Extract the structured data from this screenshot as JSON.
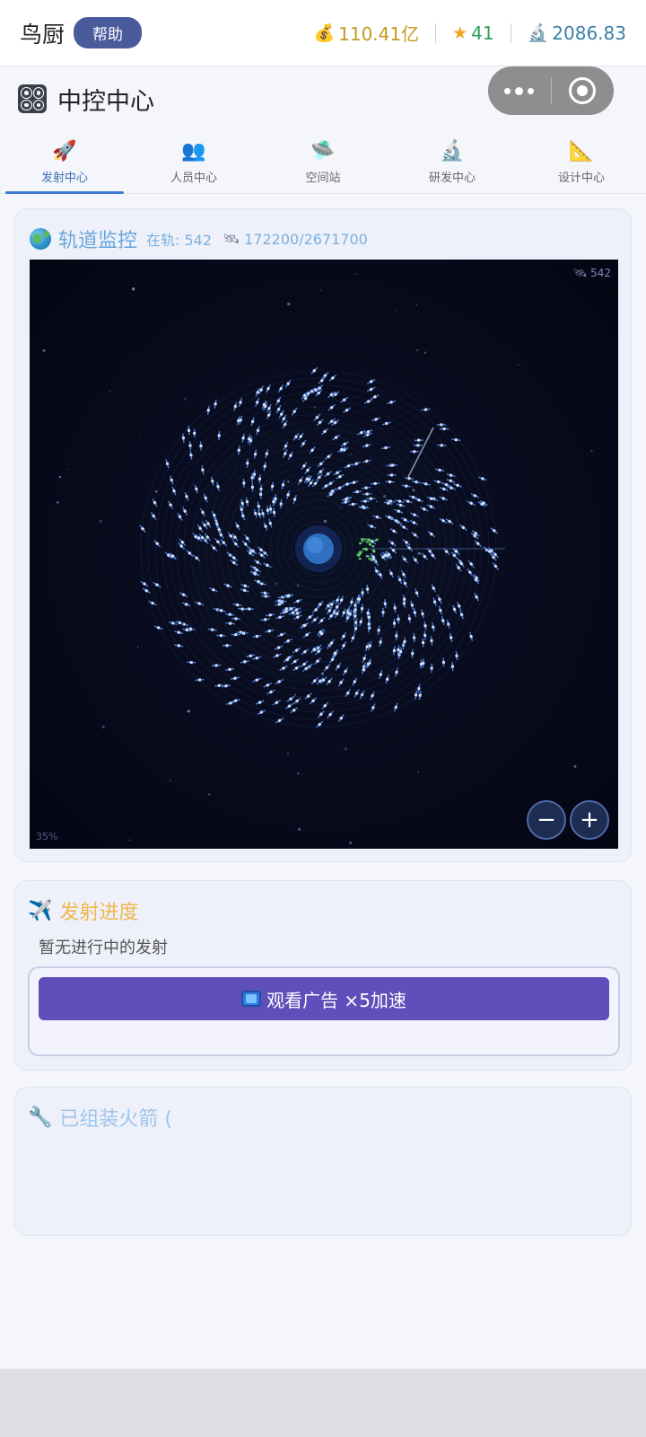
{
  "header": {
    "app_name": "鸟厨",
    "help_label": "帮助",
    "stats": {
      "money_icon": "money-bag-icon",
      "money": "110.41亿",
      "star_icon": "star-icon",
      "stars": "41",
      "science_icon": "microscope-icon",
      "science": "2086.83"
    }
  },
  "titlebar": {
    "icon": "control-panel-icon",
    "title": "中控中心"
  },
  "tabs": [
    {
      "icon": "rocket-icon",
      "glyph": "🚀",
      "label": "发射中心",
      "active": true
    },
    {
      "icon": "people-icon",
      "glyph": "👥",
      "label": "人员中心",
      "active": false
    },
    {
      "icon": "ufo-icon",
      "glyph": "🛸",
      "label": "空间站",
      "active": false
    },
    {
      "icon": "microscope-icon",
      "glyph": "🔬",
      "label": "研发中心",
      "active": false
    },
    {
      "icon": "triangle-ruler-icon",
      "glyph": "📐",
      "label": "设计中心",
      "active": false
    }
  ],
  "orbit": {
    "title": "轨道监控",
    "in_orbit": "在轨: 542",
    "progress": "172200/2671700",
    "corner_count": "542",
    "zoom": "35%",
    "zoom_out": "−",
    "zoom_in": "+"
  },
  "launch": {
    "title": "发射进度",
    "empty": "暂无进行中的发射",
    "ad_button": "观看广告 ×5加速"
  },
  "assembled": {
    "title": "已组装火箭 ("
  },
  "colors": {
    "accent": "#3d7bd0",
    "ad_button": "#5e4fba",
    "space_bg": "#07091a",
    "launch_title": "#f0b64e",
    "orbit_title": "#6aa6dc"
  }
}
